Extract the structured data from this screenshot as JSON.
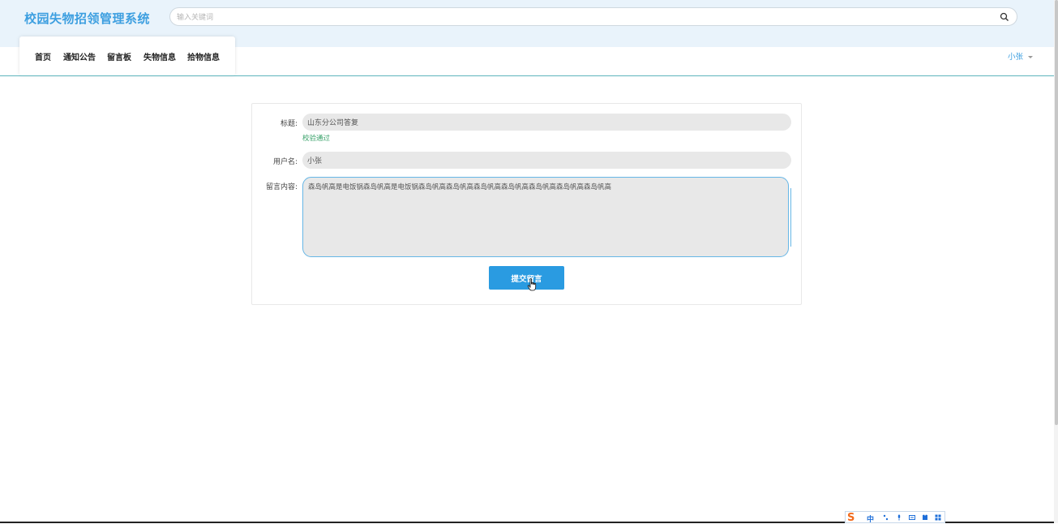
{
  "header": {
    "site_title": "校园失物招领管理系统",
    "search_placeholder": "输入关键词"
  },
  "nav": {
    "items": [
      "首页",
      "通知公告",
      "留言板",
      "失物信息",
      "拾物信息"
    ],
    "user": "小张"
  },
  "form": {
    "title_label": "标题:",
    "title_value": "山东分公司答复",
    "title_validation": "校验通过",
    "username_label": "用户名:",
    "username_value": "小张",
    "content_label": "留言内容:",
    "content_value": "森岛帆高是电饭锅森岛帆高是电饭锅森岛帆高森岛帆高森岛帆高森岛帆高森岛帆高森岛帆高森岛帆高",
    "submit_label": "提交留言"
  },
  "ime": {
    "mode": "中"
  },
  "colors": {
    "accent": "#2a9be1",
    "title": "#3d9fe0",
    "header_bg": "#e9f3fb",
    "valid": "#38a169"
  }
}
